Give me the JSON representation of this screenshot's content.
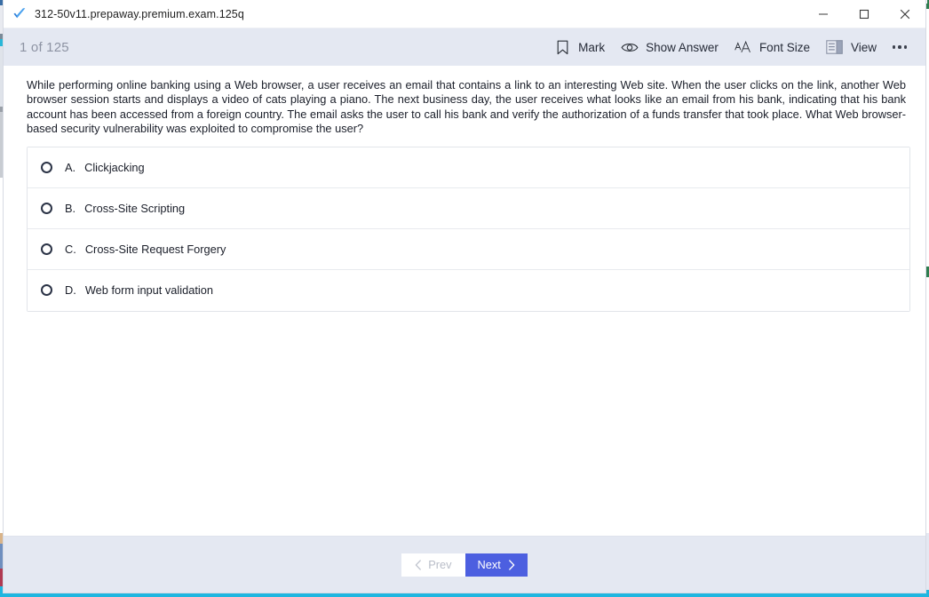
{
  "window": {
    "title": "312-50v11.prepaway.premium.exam.125q",
    "app_icon": "blue-checkmark-icon",
    "controls": {
      "minimize": "minimize-icon",
      "maximize": "maximize-icon",
      "close": "close-icon"
    }
  },
  "toolbar": {
    "counter": "1 of 125",
    "items": [
      {
        "label": "Mark",
        "icon": "bookmark-icon"
      },
      {
        "label": "Show Answer",
        "icon": "eye-icon"
      },
      {
        "label": "Font Size",
        "icon": "font-size-icon"
      },
      {
        "label": "View",
        "icon": "view-panel-icon"
      }
    ],
    "more_label": "more-options-icon"
  },
  "question": {
    "text": "While performing online banking using a Web browser, a user receives an email that contains a link to an interesting Web site. When the user clicks on the link, another Web browser session starts and displays a video of cats playing a piano. The next business day, the user receives what looks like an email from his bank, indicating that his bank account has been accessed from a foreign country. The email asks the user to call his bank and verify the authorization of a funds transfer that took place. What Web browser-based security vulnerability was exploited to compromise the user?",
    "options": [
      {
        "letter": "A.",
        "text": "Clickjacking",
        "selected": false
      },
      {
        "letter": "B.",
        "text": "Cross-Site Scripting",
        "selected": false
      },
      {
        "letter": "C.",
        "text": "Cross-Site Request Forgery",
        "selected": false
      },
      {
        "letter": "D.",
        "text": "Web form input validation",
        "selected": false
      }
    ]
  },
  "footer": {
    "prev_label": "Prev",
    "next_label": "Next",
    "prev_enabled": false,
    "next_enabled": true
  },
  "colors": {
    "toolbar_bg": "#e4e8f2",
    "next_button": "#4c5fe0",
    "counter_text": "#8d93a3",
    "radio_outline": "#2b3346"
  }
}
